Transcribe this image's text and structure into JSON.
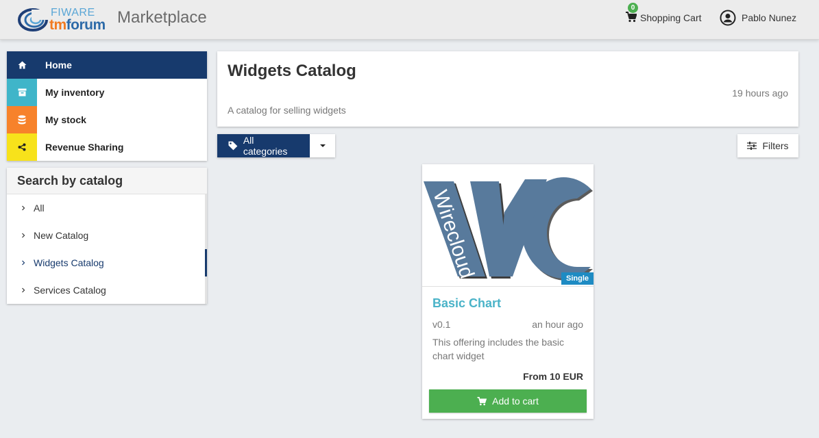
{
  "header": {
    "logo_top": "FIWARE",
    "logo_bottom_tm": "tm",
    "logo_bottom_forum": "forum",
    "app_title": "Marketplace",
    "cart_count": "0",
    "cart_label": "Shopping Cart",
    "user_name": "Pablo Nunez"
  },
  "nav": {
    "items": [
      {
        "label": "Home",
        "icon": "home-icon",
        "color": "#173a6d"
      },
      {
        "label": "My inventory",
        "icon": "archive-icon",
        "color": "#3fb5c9"
      },
      {
        "label": "My stock",
        "icon": "database-icon",
        "color": "#f7822b"
      },
      {
        "label": "Revenue Sharing",
        "icon": "share-icon",
        "color": "#f7e21b"
      }
    ]
  },
  "catalog_panel": {
    "title": "Search by catalog",
    "items": [
      {
        "label": "All"
      },
      {
        "label": "New Catalog"
      },
      {
        "label": "Widgets Catalog"
      },
      {
        "label": "Services Catalog"
      }
    ]
  },
  "catalog_info": {
    "title": "Widgets Catalog",
    "time": "19 hours ago",
    "description": "A catalog for selling widgets"
  },
  "toolbar": {
    "category_label": "All categories",
    "filters_label": "Filters"
  },
  "offering": {
    "image_text": "Wirecloud",
    "badge": "Single",
    "title": "Basic Chart",
    "version": "v0.1",
    "time": "an hour ago",
    "description": "This offering includes the basic chart widget",
    "price": "From 10 EUR",
    "add_label": "Add to cart"
  }
}
